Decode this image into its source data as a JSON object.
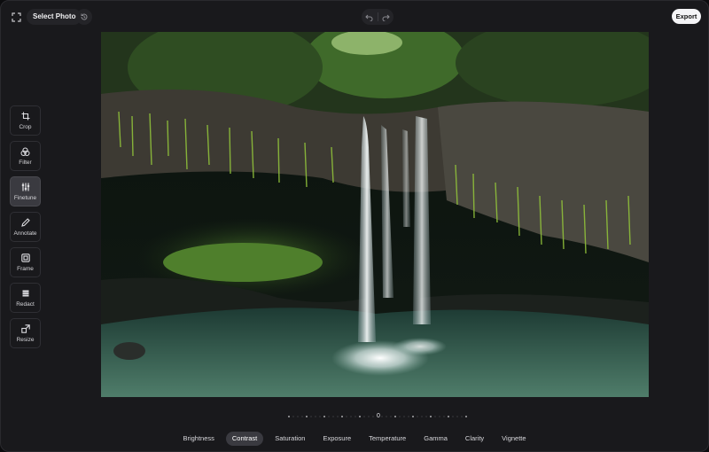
{
  "toolbar": {
    "select_photo": "Select Photo",
    "export": "Export",
    "icons": [
      "fullscreen-icon",
      "history-icon",
      "undo-icon",
      "redo-icon"
    ]
  },
  "sidebar": {
    "active": "Finetune",
    "items": [
      {
        "label": "Crop",
        "icon": "crop-icon"
      },
      {
        "label": "Filter",
        "icon": "filter-icon"
      },
      {
        "label": "Finetune",
        "icon": "sliders-icon"
      },
      {
        "label": "Annotate",
        "icon": "pencil-icon"
      },
      {
        "label": "Frame",
        "icon": "frame-icon"
      },
      {
        "label": "Redact",
        "icon": "redact-icon"
      },
      {
        "label": "Resize",
        "icon": "resize-icon"
      }
    ]
  },
  "adjustment": {
    "value": "0"
  },
  "tabs": {
    "active": "Contrast",
    "items": [
      "Brightness",
      "Contrast",
      "Saturation",
      "Exposure",
      "Temperature",
      "Gamma",
      "Clarity",
      "Vignette"
    ]
  },
  "colors": {
    "background": "#19191c",
    "active_bg": "#3a3a40",
    "export_bg": "#f4f4f6"
  }
}
